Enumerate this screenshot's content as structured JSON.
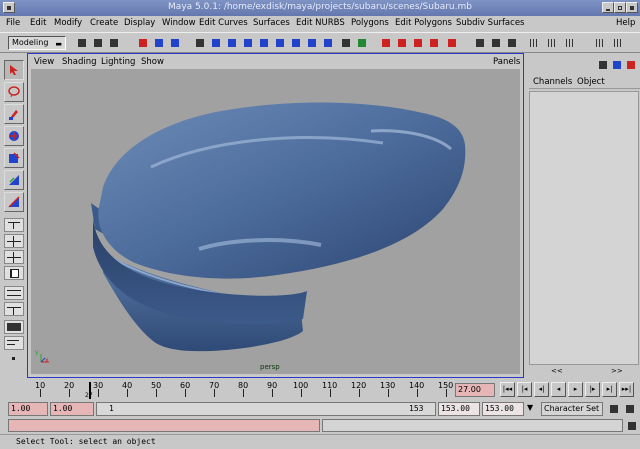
{
  "window": {
    "title": "Maya 5.0.1: /home/exdisk/maya/projects/subaru/scenes/Subaru.mb"
  },
  "menubar": {
    "items": [
      "File",
      "Edit",
      "Modify",
      "Create",
      "Display",
      "Window",
      "Edit Curves",
      "Surfaces",
      "Edit NURBS",
      "Polygons",
      "Edit Polygons",
      "Subdiv Surfaces"
    ],
    "help": "Help"
  },
  "statusline": {
    "menu_set": "Modeling"
  },
  "panel": {
    "menus": [
      "View",
      "Shading",
      "Lighting",
      "Show"
    ],
    "panels_menu": "Panels",
    "camera": "persp",
    "axis_x": "x",
    "axis_y": "y"
  },
  "channelbox": {
    "channels": "Channels",
    "object": "Object",
    "scroll_left": "<<",
    "scroll_right": ">>"
  },
  "timeline": {
    "ticks": [
      "10",
      "20",
      "30",
      "40",
      "50",
      "60",
      "70",
      "80",
      "90",
      "100",
      "110",
      "120",
      "130",
      "140",
      "150"
    ],
    "current_frame_marker": "27",
    "current_frame_field": "27.00"
  },
  "range": {
    "start_time": "1.00",
    "playback_start": "1.00",
    "range_start": "1",
    "range_end": "153",
    "playback_end": "153.00",
    "end_time": "153.00",
    "character_set": "Character Set"
  },
  "helpline": {
    "text": "Select Tool: select an object"
  },
  "colors": {
    "viewport_bg": "#a1a1a1",
    "model": "#4a6a98",
    "title_bar": "#6e82ba",
    "field_pink": "#e6b6b6"
  }
}
